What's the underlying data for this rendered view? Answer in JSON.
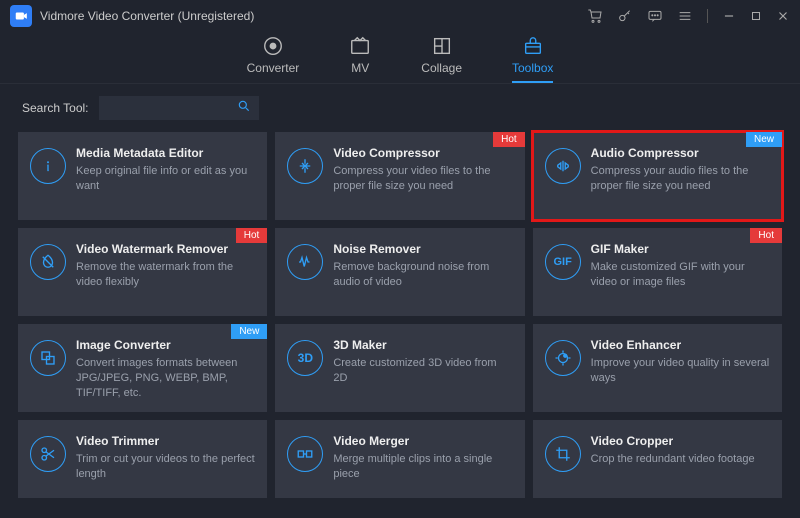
{
  "app": {
    "title": "Vidmore Video Converter (Unregistered)"
  },
  "tabs": {
    "converter": "Converter",
    "mv": "MV",
    "collage": "Collage",
    "toolbox": "Toolbox"
  },
  "search": {
    "label": "Search Tool:",
    "value": "",
    "placeholder": ""
  },
  "badges": {
    "hot": "Hot",
    "new": "New"
  },
  "tools": {
    "media_metadata": {
      "title": "Media Metadata Editor",
      "desc": "Keep original file info or edit as you want"
    },
    "video_compressor": {
      "title": "Video Compressor",
      "desc": "Compress your video files to the proper file size you need",
      "badge": "hot"
    },
    "audio_compressor": {
      "title": "Audio Compressor",
      "desc": "Compress your audio files to the proper file size you need",
      "badge": "new"
    },
    "watermark_remover": {
      "title": "Video Watermark Remover",
      "desc": "Remove the watermark from the video flexibly",
      "badge": "hot"
    },
    "noise_remover": {
      "title": "Noise Remover",
      "desc": "Remove background noise from audio of video"
    },
    "gif_maker": {
      "title": "GIF Maker",
      "desc": "Make customized GIF with your video or image files",
      "badge": "hot"
    },
    "image_converter": {
      "title": "Image Converter",
      "desc": "Convert images formats between JPG/JPEG, PNG, WEBP, BMP, TIF/TIFF, etc.",
      "badge": "new"
    },
    "3d_maker": {
      "title": "3D Maker",
      "desc": "Create customized 3D video from 2D",
      "label3d": "3D"
    },
    "video_enhancer": {
      "title": "Video Enhancer",
      "desc": "Improve your video quality in several ways"
    },
    "video_trimmer": {
      "title": "Video Trimmer",
      "desc": "Trim or cut your videos to the perfect length"
    },
    "video_merger": {
      "title": "Video Merger",
      "desc": "Merge multiple clips into a single piece"
    },
    "video_cropper": {
      "title": "Video Cropper",
      "desc": "Crop the redundant video footage"
    }
  },
  "colors": {
    "accent": "#2f9ef6",
    "card": "#343844",
    "bg": "#20242e",
    "hot": "#e53a3a"
  }
}
